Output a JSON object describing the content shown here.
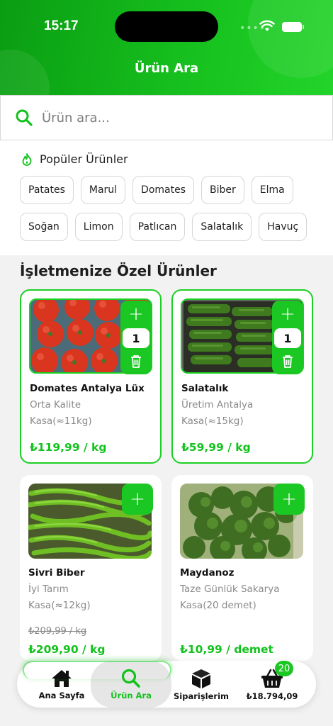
{
  "status_bar": {
    "time": "15:17"
  },
  "header": {
    "title": "Ürün Ara"
  },
  "search": {
    "placeholder": "Ürün ara..."
  },
  "popular": {
    "title": "Popüler Ürünler",
    "row1": [
      "Patates",
      "Marul",
      "Domates",
      "Biber",
      "Elma"
    ],
    "row2": [
      "Soğan",
      "Limon",
      "Patlıcan",
      "Salatalık",
      "Havuç"
    ]
  },
  "section": {
    "title": "İşletmenize Özel Ürünler"
  },
  "products": [
    {
      "name": "Domates Antalya Lüx",
      "subtitle": "Orta Kalite",
      "unit": "Kasa(≈11kg)",
      "price": "₺119,99 / kg",
      "quantity": "1",
      "selected": true,
      "image": "tomatoes"
    },
    {
      "name": "Salatalık",
      "subtitle": "Üretim Antalya",
      "unit": "Kasa(≈15kg)",
      "price": "₺59,99 / kg",
      "quantity": "1",
      "selected": true,
      "image": "cucumbers"
    },
    {
      "name": "Sivri Biber",
      "subtitle": "İyi Tarım",
      "unit": "Kasa(≈12kg)",
      "old_price": "₺209,99 / kg",
      "price": "₺209,90 / kg",
      "selected": false,
      "image": "green-peppers"
    },
    {
      "name": "Maydanoz",
      "subtitle": "Taze Günlük Sakarya",
      "unit": "Kasa(20 demet)",
      "price": "₺10,99 / demet",
      "selected": false,
      "image": "parsley"
    }
  ],
  "bottom_nav": {
    "home": "Ana Sayfa",
    "search": "Ürün Ara",
    "orders": "Siparişlerim",
    "cart_total": "₺18.794,09",
    "cart_count": "20"
  },
  "colors": {
    "brand_green": "#1bc722",
    "price_green": "#12c21c"
  },
  "icons": [
    "search-icon",
    "fire-icon",
    "plus-icon",
    "trash-icon",
    "home-icon",
    "box-icon",
    "basket-icon",
    "wifi-icon",
    "battery-icon"
  ]
}
